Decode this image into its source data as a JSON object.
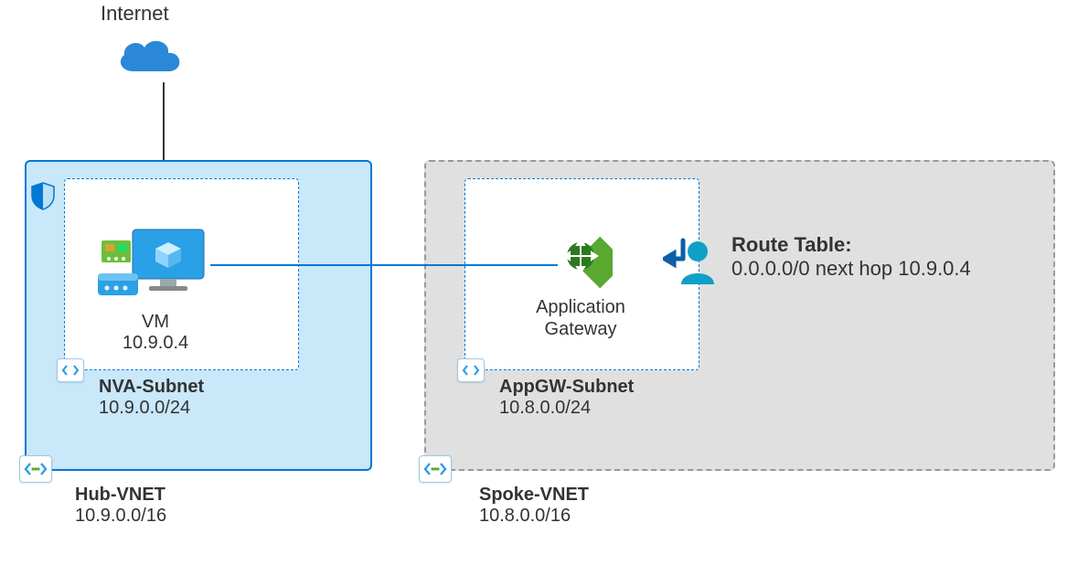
{
  "internet": {
    "label": "Internet"
  },
  "hub_vnet": {
    "name": "Hub-VNET",
    "cidr": "10.9.0.0/16"
  },
  "spoke_vnet": {
    "name": "Spoke-VNET",
    "cidr": "10.8.0.0/16"
  },
  "nva_subnet": {
    "name": "NVA-Subnet",
    "cidr": "10.9.0.0/24"
  },
  "appgw_subnet": {
    "name": "AppGW-Subnet",
    "cidr": "10.8.0.0/24"
  },
  "vm": {
    "label": "VM",
    "ip": "10.9.0.4"
  },
  "appgw": {
    "line1": "Application",
    "line2": "Gateway"
  },
  "route_table": {
    "title": "Route Table:",
    "entry": "0.0.0.0/0 next hop 10.9.0.4"
  }
}
